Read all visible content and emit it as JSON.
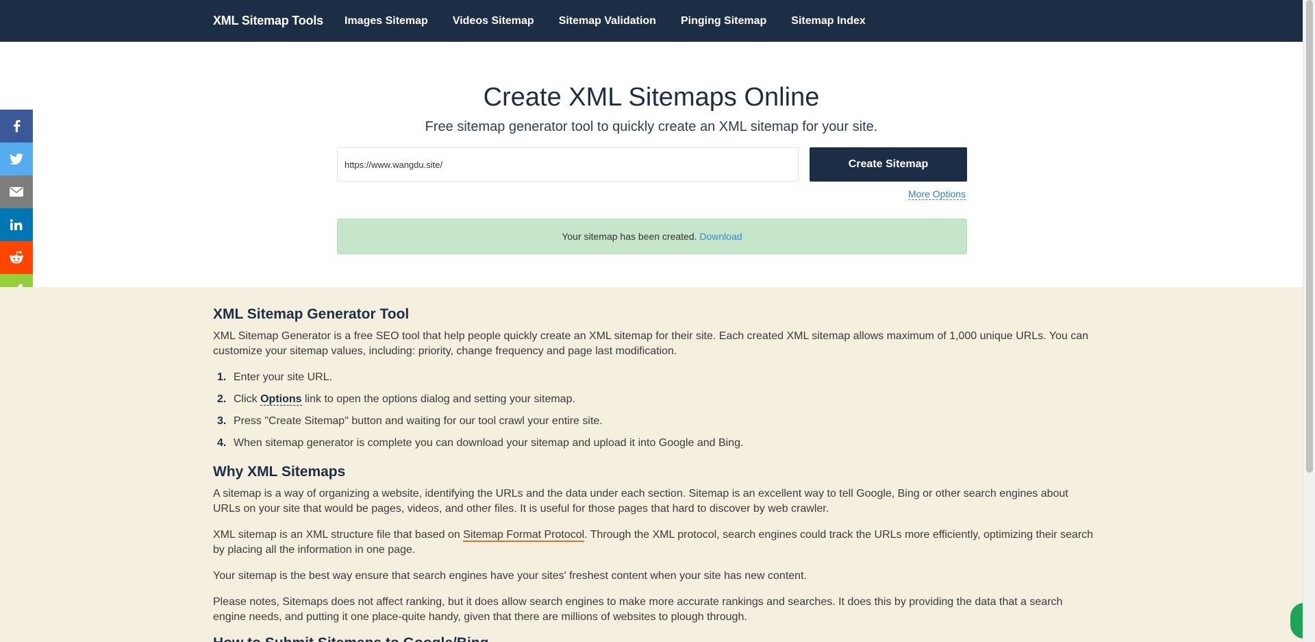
{
  "nav": {
    "brand": "XML Sitemap Tools",
    "links": [
      "Images Sitemap",
      "Videos Sitemap",
      "Sitemap Validation",
      "Pinging Sitemap",
      "Sitemap Index"
    ]
  },
  "hero": {
    "title": "Create XML Sitemaps Online",
    "subtitle": "Free sitemap generator tool to quickly create an XML sitemap for your site.",
    "url_value": "https://www.wangdu.site/",
    "create_button": "Create Sitemap",
    "more_options": "More Options",
    "alert_text": "Your sitemap has been created. ",
    "alert_link": "Download"
  },
  "social": [
    {
      "name": "facebook-icon",
      "color": "#3b5998"
    },
    {
      "name": "twitter-icon",
      "color": "#55acee"
    },
    {
      "name": "email-icon",
      "color": "#7d7d7d"
    },
    {
      "name": "linkedin-icon",
      "color": "#0077b5"
    },
    {
      "name": "reddit-icon",
      "color": "#ff4500"
    },
    {
      "name": "share-icon",
      "color": "#95d03a"
    }
  ],
  "content": {
    "h1": "XML Sitemap Generator Tool",
    "p1": "XML Sitemap Generator is a free SEO tool that help people quickly create an XML sitemap for their site. Each created XML sitemap allows maximum of 1,000 unique URLs. You can customize your sitemap values, including: priority, change frequency and page last modification.",
    "steps": [
      {
        "num": "1.",
        "text": "Enter your site URL."
      },
      {
        "num": "2.",
        "pre": "Click ",
        "link": "Options",
        "post": " link to open the options dialog and setting your sitemap."
      },
      {
        "num": "3.",
        "text": "Press \"Create Sitemap\" button and waiting for our tool crawl your entire site."
      },
      {
        "num": "4.",
        "text": "When sitemap generator is complete you can download your sitemap and upload it into Google and Bing."
      }
    ],
    "h2": "Why XML Sitemaps",
    "p2": "A sitemap is a way of organizing a website, identifying the URLs and the data under each section. Sitemap is an excellent way to tell Google, Bing or other search engines about URLs on your site that would be pages, videos, and other files. It is useful for those pages that hard to discover by web crawler.",
    "p3_pre": "XML sitemap is an XML structure file that based on ",
    "p3_link": "Sitemap Format Protocol",
    "p3_post": ". Through the XML protocol, search engines could track the URLs more efficiently, optimizing their search by placing all the information in one page.",
    "p4": "Your sitemap is the best way ensure that search engines have your sites' freshest content when your site has new content.",
    "p5": "Please notes, Sitemaps does not affect ranking, but it does allow search engines to make more accurate rankings and searches. It does this by providing the data that a search engine needs, and putting it one place-quite handy, given that there are millions of websites to plough through.",
    "h3_partial": "How to Submit Sitemaps to Google/Bing"
  }
}
